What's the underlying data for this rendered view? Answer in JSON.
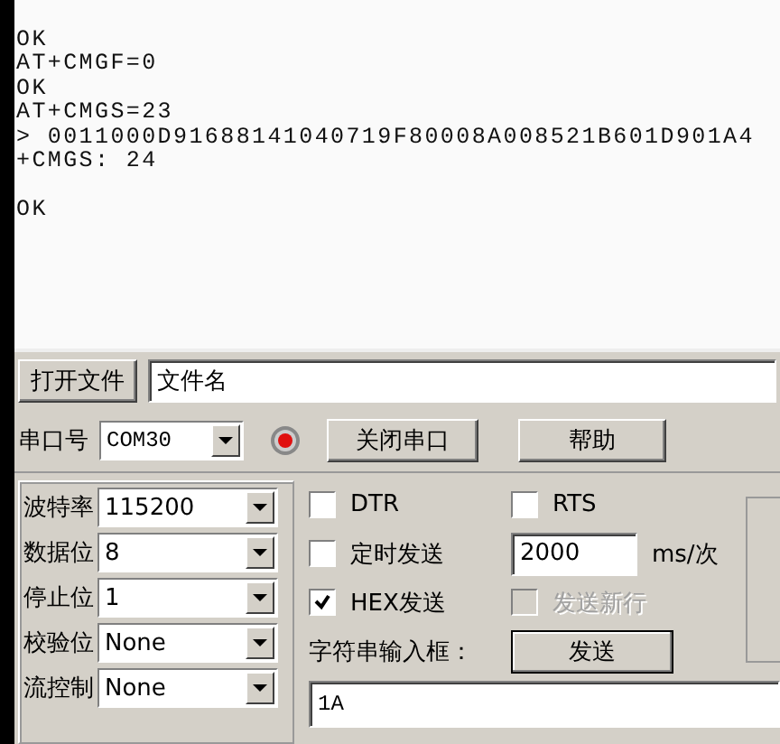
{
  "terminal": {
    "blocks": [
      {
        "lines": [
          "OK",
          "AT+CMGF=0",
          "OK",
          "AT+CMGS=23",
          "> 0011000D91688141040719F80008A008521B601D901A4",
          "+CMGS: 24"
        ]
      },
      {
        "lines": [
          "OK"
        ]
      }
    ]
  },
  "file_row": {
    "button": "打开文件",
    "filename": "文件名"
  },
  "port_row": {
    "label": "串口号",
    "port": "COM30",
    "indicator_on": true,
    "close_button": "关闭串口",
    "help_button": "帮助"
  },
  "settings": [
    {
      "label": "波特率",
      "value": "115200"
    },
    {
      "label": "数据位",
      "value": "8"
    },
    {
      "label": "停止位",
      "value": "1"
    },
    {
      "label": "校验位",
      "value": "None"
    },
    {
      "label": "流控制",
      "value": "None"
    }
  ],
  "options": {
    "dtr": {
      "label": "DTR",
      "checked": false
    },
    "rts": {
      "label": "RTS",
      "checked": false
    },
    "timed_send": {
      "label": "定时发送",
      "checked": false
    },
    "interval": "2000",
    "unit": "ms/次",
    "hex_send": {
      "label": "HEX发送",
      "checked": true
    },
    "send_newline": {
      "label": "发送新行",
      "checked": false,
      "disabled": true
    },
    "input_label": "字符串输入框：",
    "send_button": "发送",
    "input_value": "1A"
  }
}
